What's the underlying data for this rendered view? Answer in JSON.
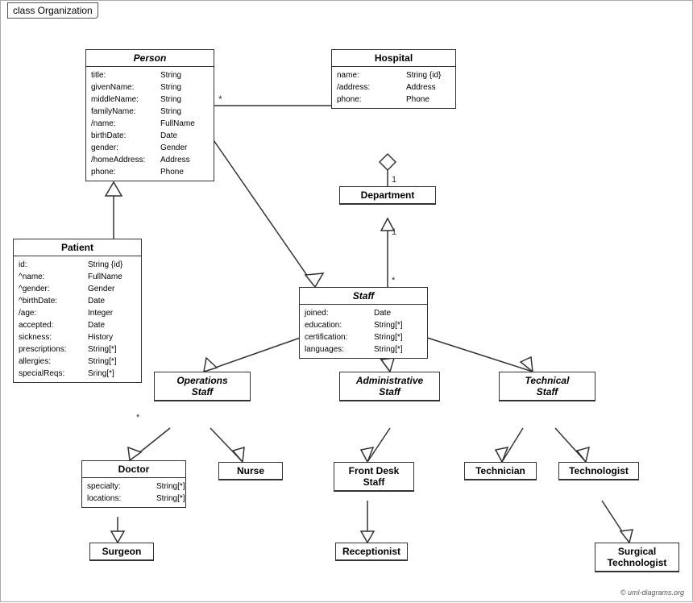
{
  "title": "class Organization",
  "copyright": "© uml-diagrams.org",
  "classes": {
    "person": {
      "name": "Person",
      "italic": true,
      "attributes": [
        {
          "name": "title:",
          "type": "String"
        },
        {
          "name": "givenName:",
          "type": "String"
        },
        {
          "name": "middleName:",
          "type": "String"
        },
        {
          "name": "familyName:",
          "type": "String"
        },
        {
          "name": "/name:",
          "type": "FullName"
        },
        {
          "name": "birthDate:",
          "type": "Date"
        },
        {
          "name": "gender:",
          "type": "Gender"
        },
        {
          "name": "/homeAddress:",
          "type": "Address"
        },
        {
          "name": "phone:",
          "type": "Phone"
        }
      ]
    },
    "hospital": {
      "name": "Hospital",
      "italic": false,
      "attributes": [
        {
          "name": "name:",
          "type": "String {id}"
        },
        {
          "name": "/address:",
          "type": "Address"
        },
        {
          "name": "phone:",
          "type": "Phone"
        }
      ]
    },
    "patient": {
      "name": "Patient",
      "italic": false,
      "attributes": [
        {
          "name": "id:",
          "type": "String {id}"
        },
        {
          "name": "^name:",
          "type": "FullName"
        },
        {
          "name": "^gender:",
          "type": "Gender"
        },
        {
          "name": "^birthDate:",
          "type": "Date"
        },
        {
          "name": "/age:",
          "type": "Integer"
        },
        {
          "name": "accepted:",
          "type": "Date"
        },
        {
          "name": "sickness:",
          "type": "History"
        },
        {
          "name": "prescriptions:",
          "type": "String[*]"
        },
        {
          "name": "allergies:",
          "type": "String[*]"
        },
        {
          "name": "specialReqs:",
          "type": "Sring[*]"
        }
      ]
    },
    "department": {
      "name": "Department",
      "italic": false,
      "attributes": []
    },
    "staff": {
      "name": "Staff",
      "italic": true,
      "attributes": [
        {
          "name": "joined:",
          "type": "Date"
        },
        {
          "name": "education:",
          "type": "String[*]"
        },
        {
          "name": "certification:",
          "type": "String[*]"
        },
        {
          "name": "languages:",
          "type": "String[*]"
        }
      ]
    },
    "operationsStaff": {
      "name": "Operations Staff",
      "italic": true,
      "attributes": []
    },
    "administrativeStaff": {
      "name": "Administrative Staff",
      "italic": true,
      "attributes": []
    },
    "technicalStaff": {
      "name": "Technical Staff",
      "italic": true,
      "attributes": []
    },
    "doctor": {
      "name": "Doctor",
      "italic": false,
      "attributes": [
        {
          "name": "specialty:",
          "type": "String[*]"
        },
        {
          "name": "locations:",
          "type": "String[*]"
        }
      ]
    },
    "nurse": {
      "name": "Nurse",
      "italic": false,
      "attributes": []
    },
    "frontDeskStaff": {
      "name": "Front Desk Staff",
      "italic": false,
      "attributes": []
    },
    "technician": {
      "name": "Technician",
      "italic": false,
      "attributes": []
    },
    "technologist": {
      "name": "Technologist",
      "italic": false,
      "attributes": []
    },
    "surgeon": {
      "name": "Surgeon",
      "italic": false,
      "attributes": []
    },
    "receptionist": {
      "name": "Receptionist",
      "italic": false,
      "attributes": []
    },
    "surgicalTechnologist": {
      "name": "Surgical Technologist",
      "italic": false,
      "attributes": []
    }
  }
}
